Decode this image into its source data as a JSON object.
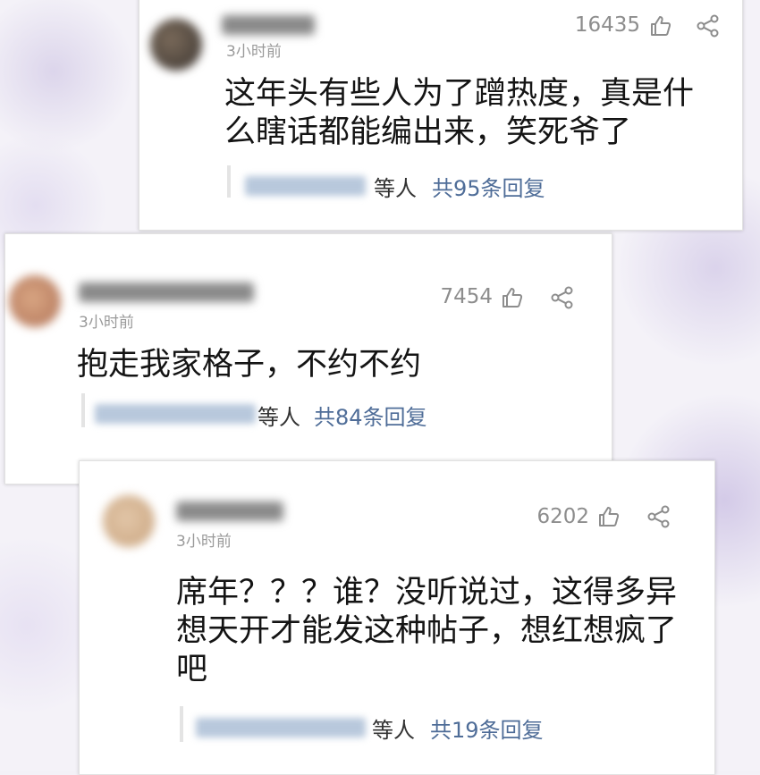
{
  "comments": [
    {
      "time": "3小时前",
      "like_count": "16435",
      "content": "这年头有些人为了蹭热度，真是什么瞎话都能编出来，笑死爷了",
      "reply_suffix": "等人",
      "reply_total": "共95条回复",
      "avatar_color": "#5a5048"
    },
    {
      "time": "3小时前",
      "like_count": "7454",
      "content": "抱走我家格子，不约不约",
      "reply_suffix": "等人",
      "reply_total": "共84条回复",
      "avatar_color": "#c98f6e"
    },
    {
      "time": "3小时前",
      "like_count": "6202",
      "content": "席年？？？谁？没听说过，这得多异想天开才能发这种帖子，想红想疯了吧",
      "reply_suffix": "等人",
      "reply_total": "共19条回复",
      "avatar_color": "#d6b898"
    }
  ],
  "icons": {
    "like": "thumbs-up-icon",
    "share": "share-icon"
  },
  "colors": {
    "link": "#4f6d98",
    "meta": "#9a9a9a",
    "text": "#141414"
  }
}
